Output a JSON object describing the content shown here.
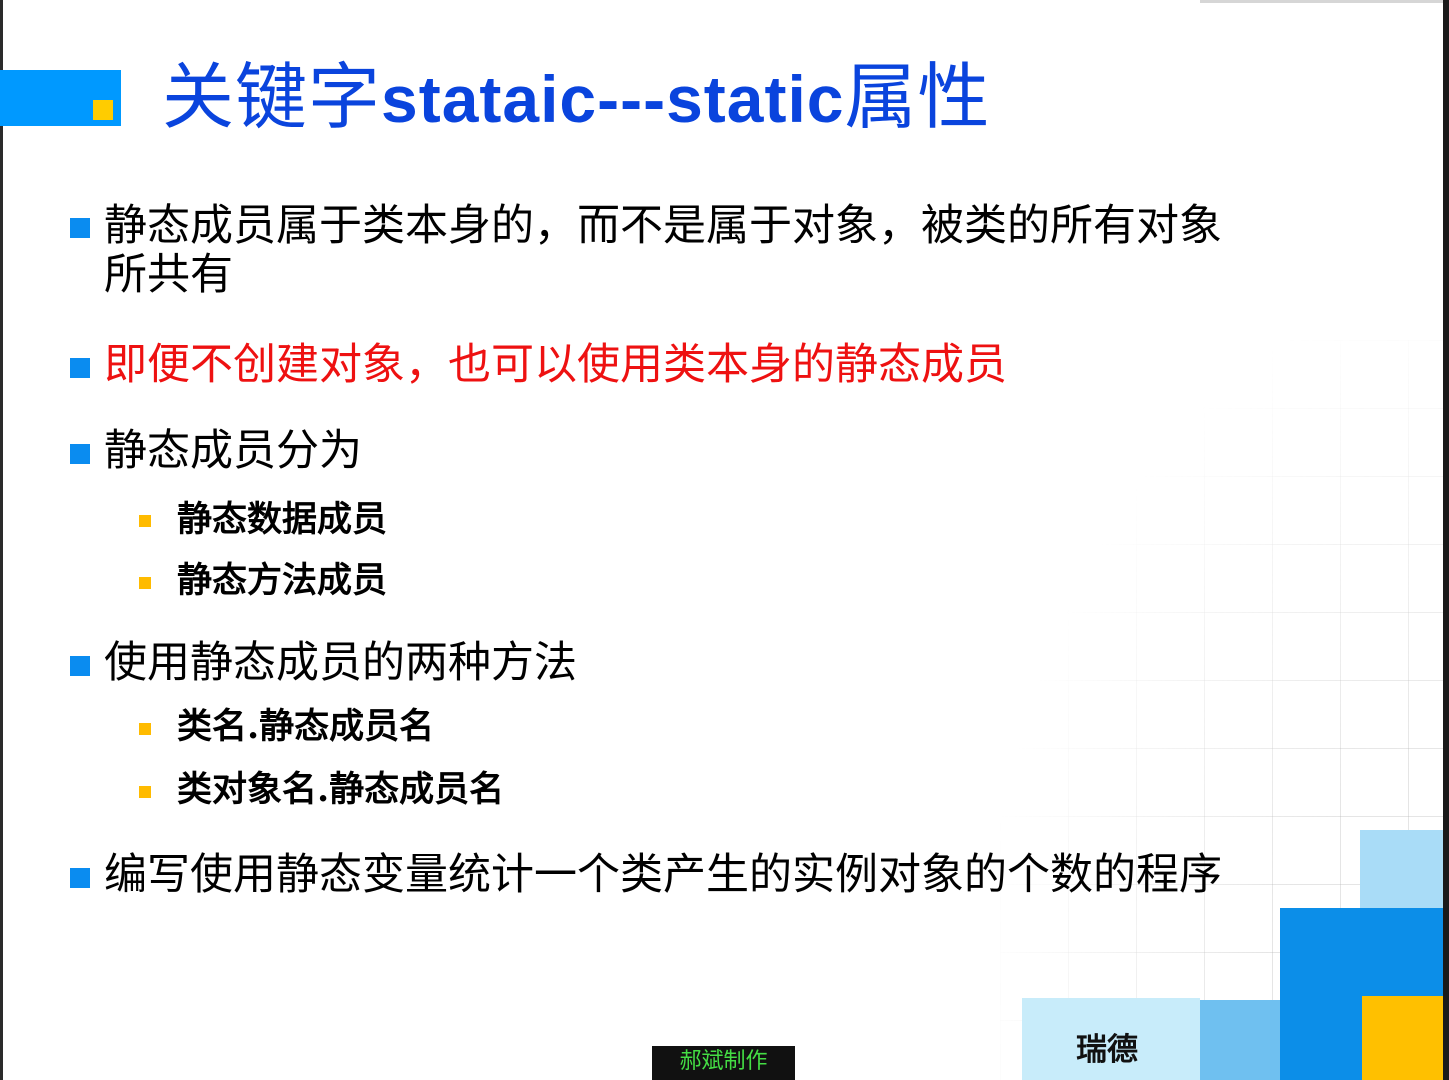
{
  "title": {
    "prefix": "关键字",
    "latin": "stataic---static",
    "suffix": "属性"
  },
  "bullets": [
    {
      "line1": "静态成员属于类本身的，而不是属于对象，被类的所有对象",
      "line2": "所共有"
    },
    {
      "text": "即便不创建对象，也可以使用类本身的静态成员"
    },
    {
      "text": "静态成员分为"
    },
    {
      "text": "使用静态成员的两种方法"
    },
    {
      "text": "编写使用静态变量统计一个类产生的实例对象的个数的程序"
    }
  ],
  "sub_bullets": {
    "types": [
      "静态数据成员",
      "静态方法成员"
    ],
    "methods": [
      "类名.静态成员名",
      "类对象名.静态成员名"
    ]
  },
  "footer": {
    "logo_text": "瑞德",
    "credit": "郝斌制作"
  },
  "colors": {
    "title": "#0a44dd",
    "highlight": "#ee1111",
    "bullet_primary": "#0a8cf0",
    "bullet_secondary": "#ffbb00"
  }
}
